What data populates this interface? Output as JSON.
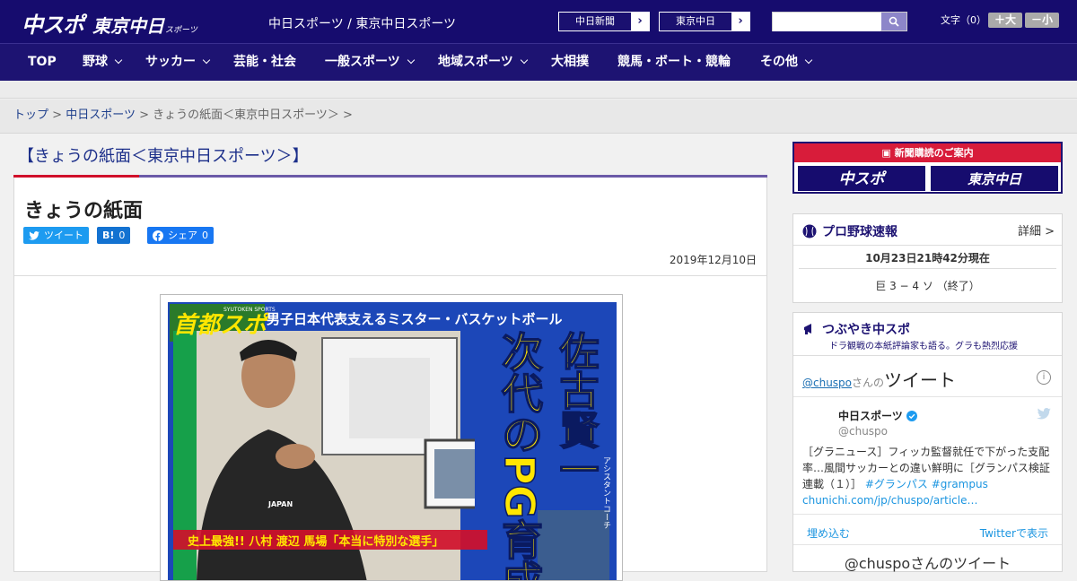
{
  "header": {
    "logo_main": "中スポ",
    "logo_tokyo": "東京中日",
    "logo_sub": "スポーツ",
    "site_name": "中日スポーツ / 東京中日スポーツ",
    "paper_links": [
      "中日新聞",
      "東京中日"
    ],
    "search_placeholder": "",
    "font_label": "文字（0）",
    "font_bigger": "＋大",
    "font_smaller": "－小"
  },
  "nav": {
    "items": [
      {
        "label": "TOP",
        "dropdown": false
      },
      {
        "label": "野球",
        "dropdown": true
      },
      {
        "label": "サッカー",
        "dropdown": true
      },
      {
        "label": "芸能・社会",
        "dropdown": false
      },
      {
        "label": "一般スポーツ",
        "dropdown": true
      },
      {
        "label": "地域スポーツ",
        "dropdown": true
      },
      {
        "label": "大相撲",
        "dropdown": false
      },
      {
        "label": "競馬・ボート・競輪",
        "dropdown": false
      },
      {
        "label": "その他",
        "dropdown": true
      }
    ]
  },
  "breadcrumb": {
    "top": "トップ",
    "sep": ">",
    "chunichi": "中日スポーツ",
    "current": "きょうの紙面＜東京中日スポーツ＞ >"
  },
  "main": {
    "page_heading": "【きょうの紙面＜東京中日スポーツ＞】",
    "article_title": "きょうの紙面",
    "share": {
      "tweet": "ツイート",
      "hatena_count": "0",
      "facebook": "シェア",
      "facebook_count": "0"
    },
    "date": "2019年12月10日",
    "paper": {
      "masthead": "首都スポ",
      "masthead_en": "SYUTOKEN SPORTS",
      "headline_top": "男子日本代表支えるミスター・バスケットボール",
      "headline_name": "佐古賢一",
      "headline_main": "次代のPG育成",
      "headline_sub": "アシスタントコーチ",
      "bottom_text": "史上最強!! 八村 渡辺 馬場「本当に特別な選手」",
      "shirt_text": "JAPAN"
    }
  },
  "sidebar": {
    "subscribe_label": "新聞購読のご案内",
    "subscribe_logos": [
      "中スポ",
      "東京中日"
    ],
    "baseball": {
      "title": "プロ野球速報",
      "detail": "詳細 >",
      "timestamp": "10月23日21時42分現在",
      "score": "巨 3 − 4 ソ （終了）"
    },
    "tweets": {
      "title": "つぶやき中スポ",
      "subtitle": "ドラ観戦の本紙評論家も語る。グラも熱烈応援",
      "account_link": "@chuspo",
      "account_suffix": "さんの",
      "header_big": "ツイート",
      "author": "中日スポーツ",
      "handle": "@chuspo",
      "body": "［グラニュース］フィッカ監督就任で下がった支配率…風間サッカーとの違い鮮明に［グランパス検証連載（１）］",
      "hashtags": "#グランパス #grampus",
      "link": "chunichi.com/jp/chuspo/article…",
      "embed": "埋め込む",
      "view_on_twitter": "Twitterで表示",
      "footer": "@chuspoさんのツイート"
    }
  },
  "colors": {
    "header_bg": "#160c6e",
    "nav_bg": "#1d1372",
    "accent_red": "#d0102a",
    "link_blue": "#1e3f8c"
  }
}
